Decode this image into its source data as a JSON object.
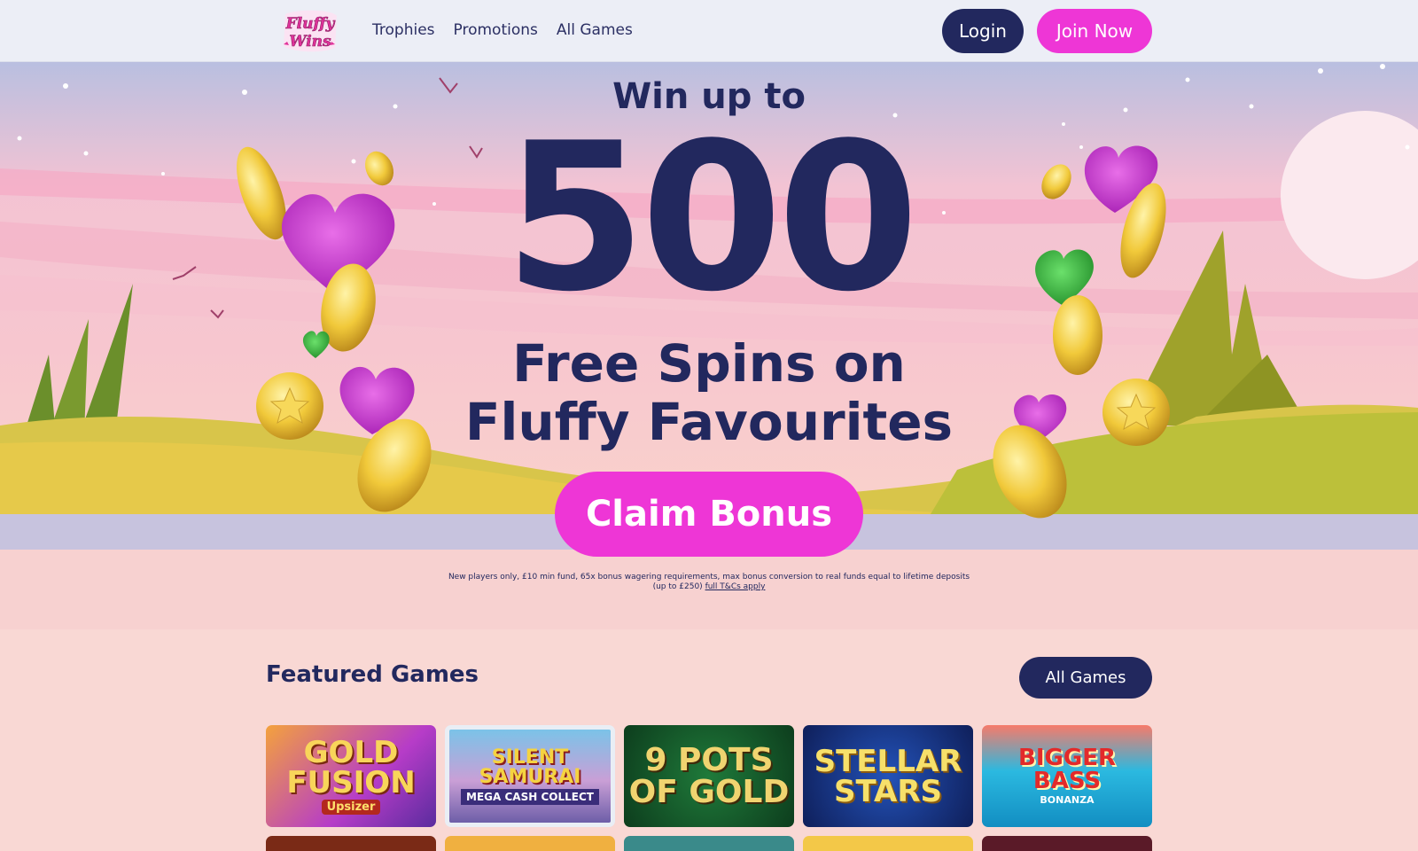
{
  "header": {
    "logo_text": "Fluffy Wins",
    "nav": [
      "Trophies",
      "Promotions",
      "All Games"
    ],
    "login_label": "Login",
    "join_label": "Join Now"
  },
  "hero": {
    "line1": "Win up to",
    "amount": "500",
    "line2": "Free Spins on",
    "line3": "Fluffy Favourites",
    "cta_label": "Claim Bonus",
    "terms_text": "New players only, £10 min fund, 65x bonus wagering requirements, max bonus conversion to real funds equal to lifetime deposits (up to £250)",
    "terms_link": "full T&Cs apply"
  },
  "featured": {
    "title": "Featured Games",
    "all_games_label": "All Games",
    "games": [
      {
        "title": "GOLD FUSION",
        "subtitle": "Upsizer"
      },
      {
        "title": "SILENT SAMURAI",
        "subtitle": "MEGA CASH COLLECT"
      },
      {
        "title": "9 POTS OF GOLD",
        "subtitle": ""
      },
      {
        "title": "STELLAR STARS",
        "subtitle": ""
      },
      {
        "title": "BIGGER BASS",
        "subtitle": "BONANZA"
      }
    ]
  },
  "colors": {
    "navy": "#22285e",
    "pink": "#ee36d6",
    "header_bg": "#eceef6",
    "page_bg": "#f9d8d4"
  }
}
